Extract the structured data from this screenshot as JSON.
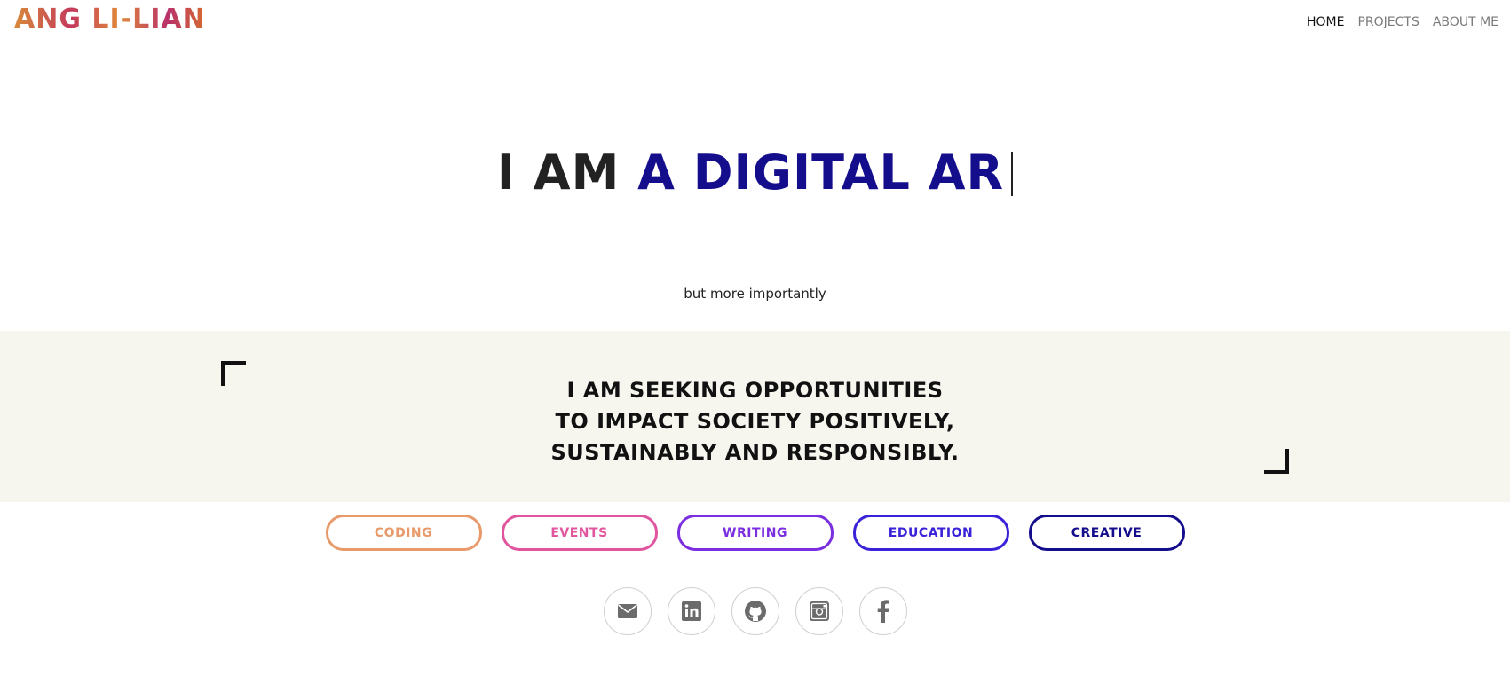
{
  "header": {
    "logo_text": "ANG LI-LIAN",
    "nav": [
      {
        "label": "HOME",
        "active": true
      },
      {
        "label": "PROJECTS",
        "active": false
      },
      {
        "label": "ABOUT ME",
        "active": false
      }
    ]
  },
  "hero": {
    "static_text": "I AM",
    "typed_text": "A DIGITAL AR"
  },
  "subtitle": "but more importantly",
  "statement": {
    "line1": "I AM SEEKING OPPORTUNITIES",
    "line2": "TO IMPACT SOCIETY POSITIVELY,",
    "line3": "SUSTAINABLY AND RESPONSIBLY."
  },
  "categories": [
    {
      "label": "CODING",
      "color": "#e89a6a"
    },
    {
      "label": "EVENTS",
      "color": "#e0559e"
    },
    {
      "label": "WRITING",
      "color": "#7b2ee0"
    },
    {
      "label": "EDUCATION",
      "color": "#3a22d8"
    },
    {
      "label": "CREATIVE",
      "color": "#140d8c"
    }
  ],
  "socials": [
    {
      "icon": "mail-icon"
    },
    {
      "icon": "linkedin-icon"
    },
    {
      "icon": "github-icon"
    },
    {
      "icon": "instagram-icon"
    },
    {
      "icon": "facebook-icon"
    }
  ],
  "colors": {
    "accent": "#140d8c",
    "band_background": "#f6f5ee",
    "icon_gray": "#6b6b6b"
  }
}
